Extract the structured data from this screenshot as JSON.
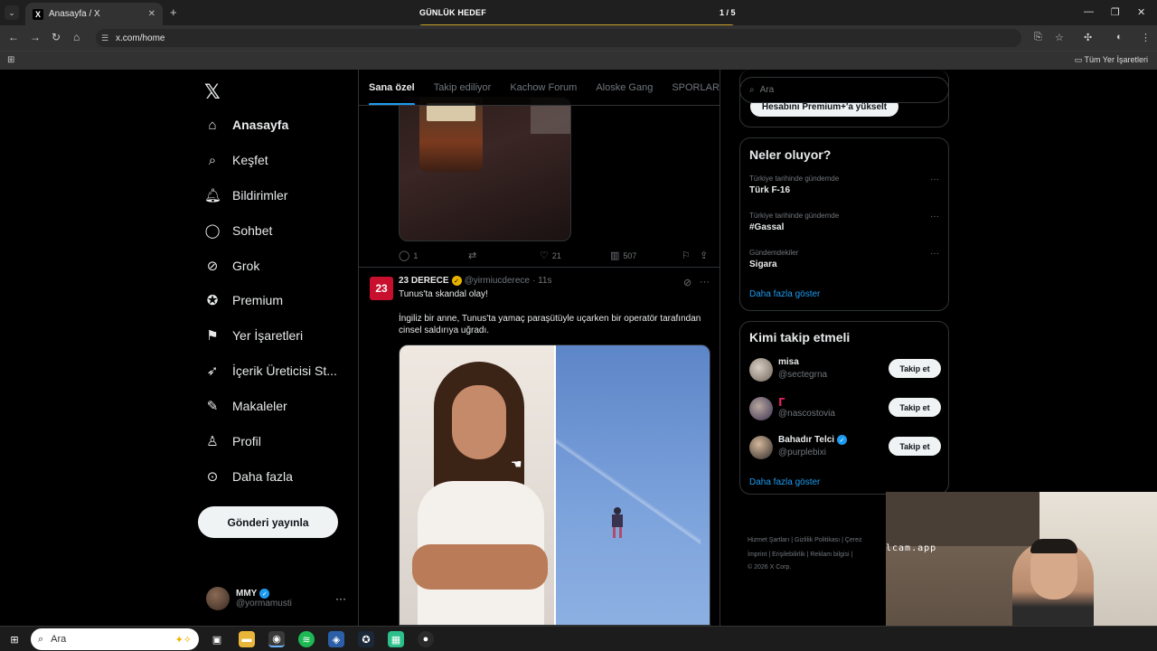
{
  "browser": {
    "tab_title": "Anasayfa / X",
    "url": "x.com/home",
    "all_bookmarks": "Tüm Yer İşaretleri",
    "goal_label": "GÜNLÜK HEDEF",
    "goal_count": "1 / 5",
    "goal_progress": 0.2
  },
  "nav": {
    "items": [
      {
        "label": "Anasayfa",
        "icon": "home-icon"
      },
      {
        "label": "Keşfet",
        "icon": "search-icon"
      },
      {
        "label": "Bildirimler",
        "icon": "bell-icon"
      },
      {
        "label": "Sohbet",
        "icon": "chat-icon"
      },
      {
        "label": "Grok",
        "icon": "grok-icon"
      },
      {
        "label": "Premium",
        "icon": "premium-icon"
      },
      {
        "label": "Yer İşaretleri",
        "icon": "bookmark-icon"
      },
      {
        "label": "İçerik Üreticisi St...",
        "icon": "rocket-icon"
      },
      {
        "label": "Makaleler",
        "icon": "article-icon"
      },
      {
        "label": "Profil",
        "icon": "profile-icon"
      },
      {
        "label": "Daha fazla",
        "icon": "more-icon"
      }
    ],
    "post_button": "Gönderi yayınla",
    "me": {
      "name": "MMY",
      "handle": "@yormamusti"
    }
  },
  "feed": {
    "tabs": [
      "Sana özel",
      "Takip ediliyor",
      "Kachow Forum",
      "Aloske Gang",
      "SPORLAR YAP"
    ],
    "prev_actions": {
      "replies": "1",
      "likes": "21",
      "views": "507"
    },
    "tweet": {
      "avatar_text": "23",
      "name": "23 DERECE",
      "handle": "@yirmiucderece",
      "time": "· 11s",
      "title": "Tunus'ta skandal olay!",
      "body": "İngiliz bir anne, Tunus'ta yamaç paraşütüyle uçarken bir operatör tarafından cinsel saldırıya uğradı."
    }
  },
  "right": {
    "search_placeholder": "Ara",
    "premium_button": "Hesabını Premium+'a yükselt",
    "trends_title": "Neler oluyor?",
    "trends": [
      {
        "context": "Türkiye tarihinde gündemde",
        "title": "Türk F-16"
      },
      {
        "context": "Türkiye tarihinde gündemde",
        "title": "#Gassal"
      },
      {
        "context": "Gündemdekiler",
        "title": "Sigara"
      }
    ],
    "show_more": "Daha fazla göster",
    "who_title": "Kimi takip etmeli",
    "who": [
      {
        "name": "misa",
        "handle": "@sectegrna",
        "verified": false
      },
      {
        "name": "",
        "handle": "@nascostovia",
        "verified": false
      },
      {
        "name": "Bahadır Telci",
        "handle": "@purplebixi",
        "verified": true
      }
    ],
    "follow_label": "Takip et",
    "footer_line1": "Hizmet Şartları  |  Gizlilik Politikası  |  Çerez",
    "footer_line2": "İmprint  |  Erişilebilirlik  |  Reklam bilgisi  |",
    "footer_line3": "© 2026 X Corp."
  },
  "webcam": {
    "watermark": "lcam.app"
  },
  "taskbar": {
    "search_placeholder": "Ara"
  }
}
